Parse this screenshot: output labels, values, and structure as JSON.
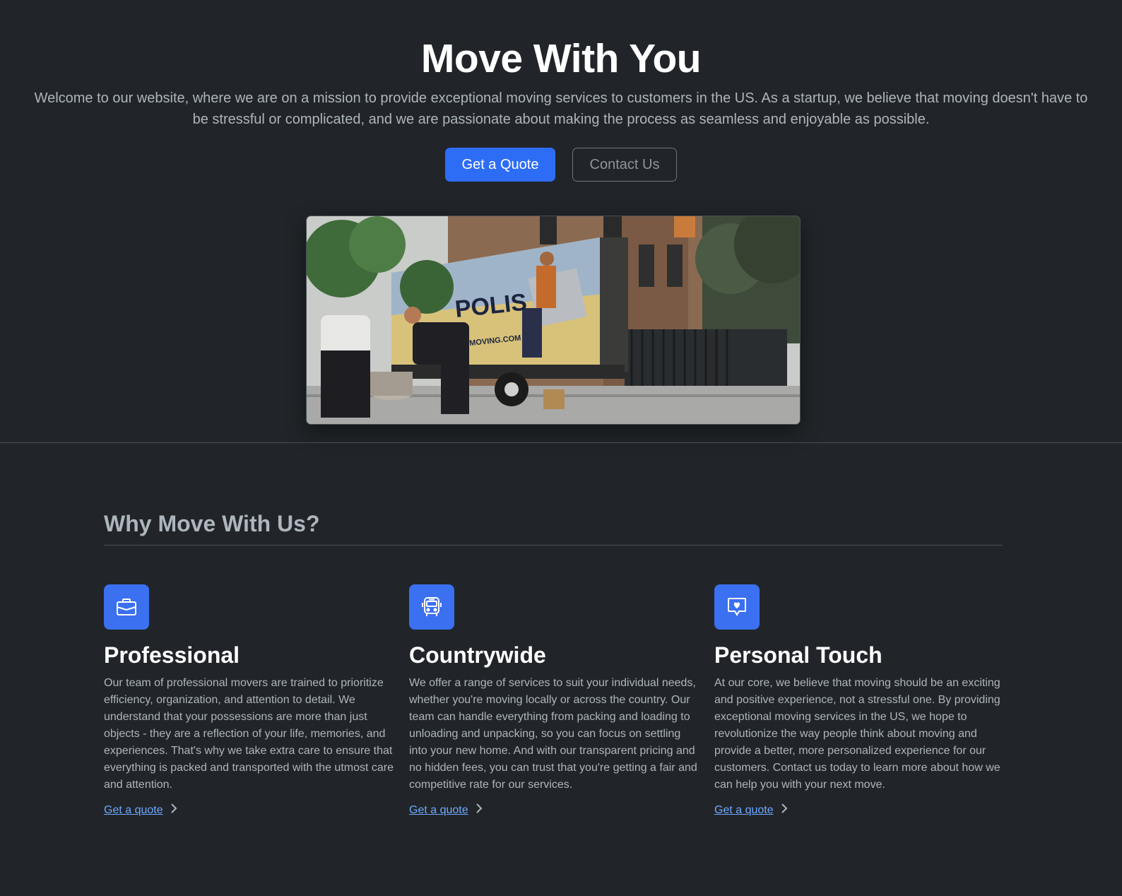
{
  "hero": {
    "title": "Move With You",
    "lead": "Welcome to our website, where we are on a mission to provide exceptional moving services to customers in the US. As a startup, we believe that moving doesn't have to be stressful or complicated, and we are passionate about making the process as seamless and enjoyable as possible.",
    "primary_button": "Get a Quote",
    "secondary_button": "Contact Us"
  },
  "features": {
    "heading": "Why Move With Us?",
    "items": [
      {
        "icon": "briefcase-icon",
        "title": "Professional",
        "text": "Our team of professional movers are trained to prioritize efficiency, organization, and attention to detail. We understand that your possessions are more than just objects - they are a reflection of your life, memories, and experiences. That's why we take extra care to ensure that everything is packed and transported with the utmost care and attention.",
        "link": "Get a quote"
      },
      {
        "icon": "bus-icon",
        "title": "Countrywide",
        "text": "We offer a range of services to suit your individual needs, whether you're moving locally or across the country. Our team can handle everything from packing and loading to unloading and unpacking, so you can focus on settling into your new home. And with our transparent pricing and no hidden fees, you can trust that you're getting a fair and competitive rate for our services.",
        "link": "Get a quote"
      },
      {
        "icon": "chat-heart-icon",
        "title": "Personal Touch",
        "text": "At our core, we believe that moving should be an exciting and positive experience, not a stressful one. By providing exceptional moving services in the US, we hope to revolutionize the way people think about moving and provide a better, more personalized experience for our customers. Contact us today to learn more about how we can help you with your next move.",
        "link": "Get a quote"
      }
    ]
  },
  "colors": {
    "background": "#212529",
    "accent": "#2d6df6",
    "link": "#6ea8fe"
  }
}
